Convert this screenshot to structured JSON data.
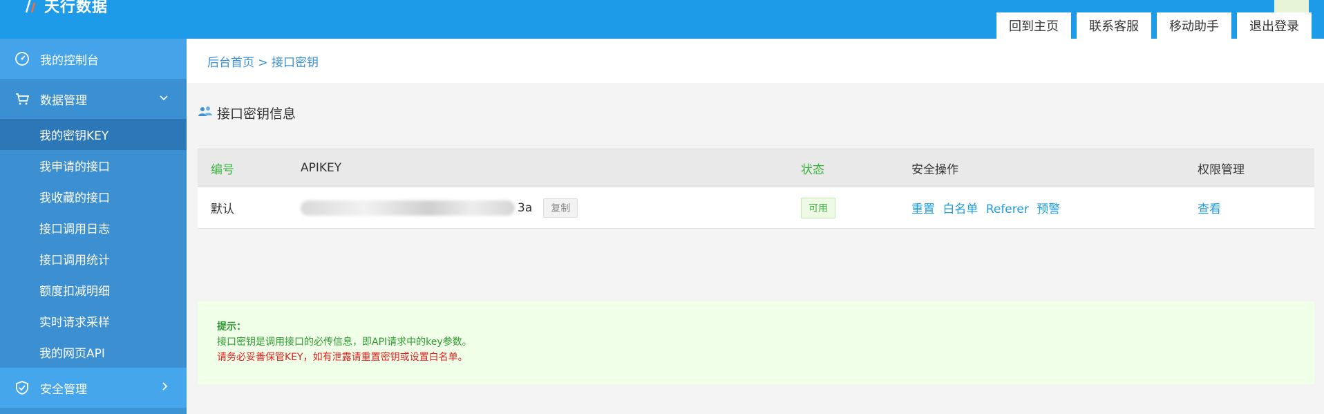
{
  "header": {
    "logo_text": "天行数据",
    "nav": [
      "回到主页",
      "联系客服",
      "移动助手",
      "退出登录"
    ]
  },
  "sidebar": {
    "console": "我的控制台",
    "data_mgmt": "数据管理",
    "sub_items": [
      "我的密钥KEY",
      "我申请的接口",
      "我收藏的接口",
      "接口调用日志",
      "接口调用统计",
      "额度扣减明细",
      "实时请求采样",
      "我的网页API"
    ],
    "security": "安全管理"
  },
  "main": {
    "breadcrumb": "后台首页 > 接口密钥",
    "section_title": "接口密钥信息",
    "table": {
      "headers": [
        "编号",
        "APIKEY",
        "状态",
        "安全操作",
        "权限管理"
      ],
      "row": {
        "id": "默认",
        "key_tail": "3a",
        "copy": "复制",
        "status": "可用",
        "ops": [
          "重置",
          "白名单",
          "Referer",
          "预警"
        ],
        "perm": "查看"
      }
    },
    "tip": {
      "title": "提示：",
      "line1": "接口密钥是调用接口的必传信息，即API请求中的key参数。",
      "line2": "请务必妥善保管KEY，如有泄露请重置密钥或设置白名单。"
    }
  },
  "colors": {
    "header_bg": "#1e9be8",
    "sidebar_bg": "#3c94d5",
    "active_item": "#2b77b8",
    "link": "#1d9ddb",
    "green": "#3ab43e",
    "red": "#e02020"
  }
}
